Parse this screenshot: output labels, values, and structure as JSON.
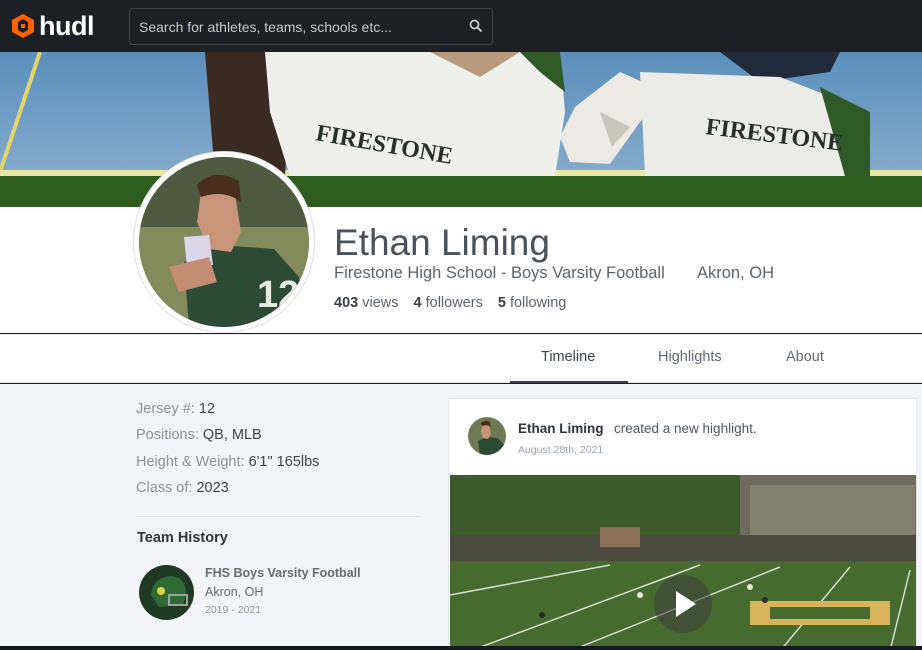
{
  "brand": {
    "name": "hudl",
    "accent": "#ff6300"
  },
  "search": {
    "placeholder": "Search for athletes, teams, schools etc..."
  },
  "profile": {
    "name": "Ethan Liming",
    "school": "Firestone High School - Boys Varsity Football",
    "location": "Akron, OH",
    "stats": {
      "views_count": "403",
      "views_label": "views",
      "followers_count": "4",
      "followers_label": "followers",
      "following_count": "5",
      "following_label": "following"
    },
    "jersey_number_on_photo": "12"
  },
  "cover": {
    "jersey_text": "FIRESTONE"
  },
  "tabs": [
    {
      "label": "Timeline",
      "active": true
    },
    {
      "label": "Highlights",
      "active": false
    },
    {
      "label": "About",
      "active": false
    }
  ],
  "about": {
    "jersey_label": "Jersey #:",
    "jersey_value": "12",
    "positions_label": "Positions:",
    "positions_value": "QB, MLB",
    "hw_label": "Height & Weight:",
    "hw_value": "6'1\" 165lbs",
    "class_label": "Class of:",
    "class_value": "2023"
  },
  "team_history": {
    "title": "Team History",
    "teams": [
      {
        "name": "FHS Boys Varsity Football",
        "location": "Akron, OH",
        "years": "2019 - 2021"
      }
    ]
  },
  "feed": [
    {
      "author": "Ethan Liming",
      "action": "created a new highlight.",
      "date": "August 28th, 2021",
      "media": "video"
    }
  ]
}
